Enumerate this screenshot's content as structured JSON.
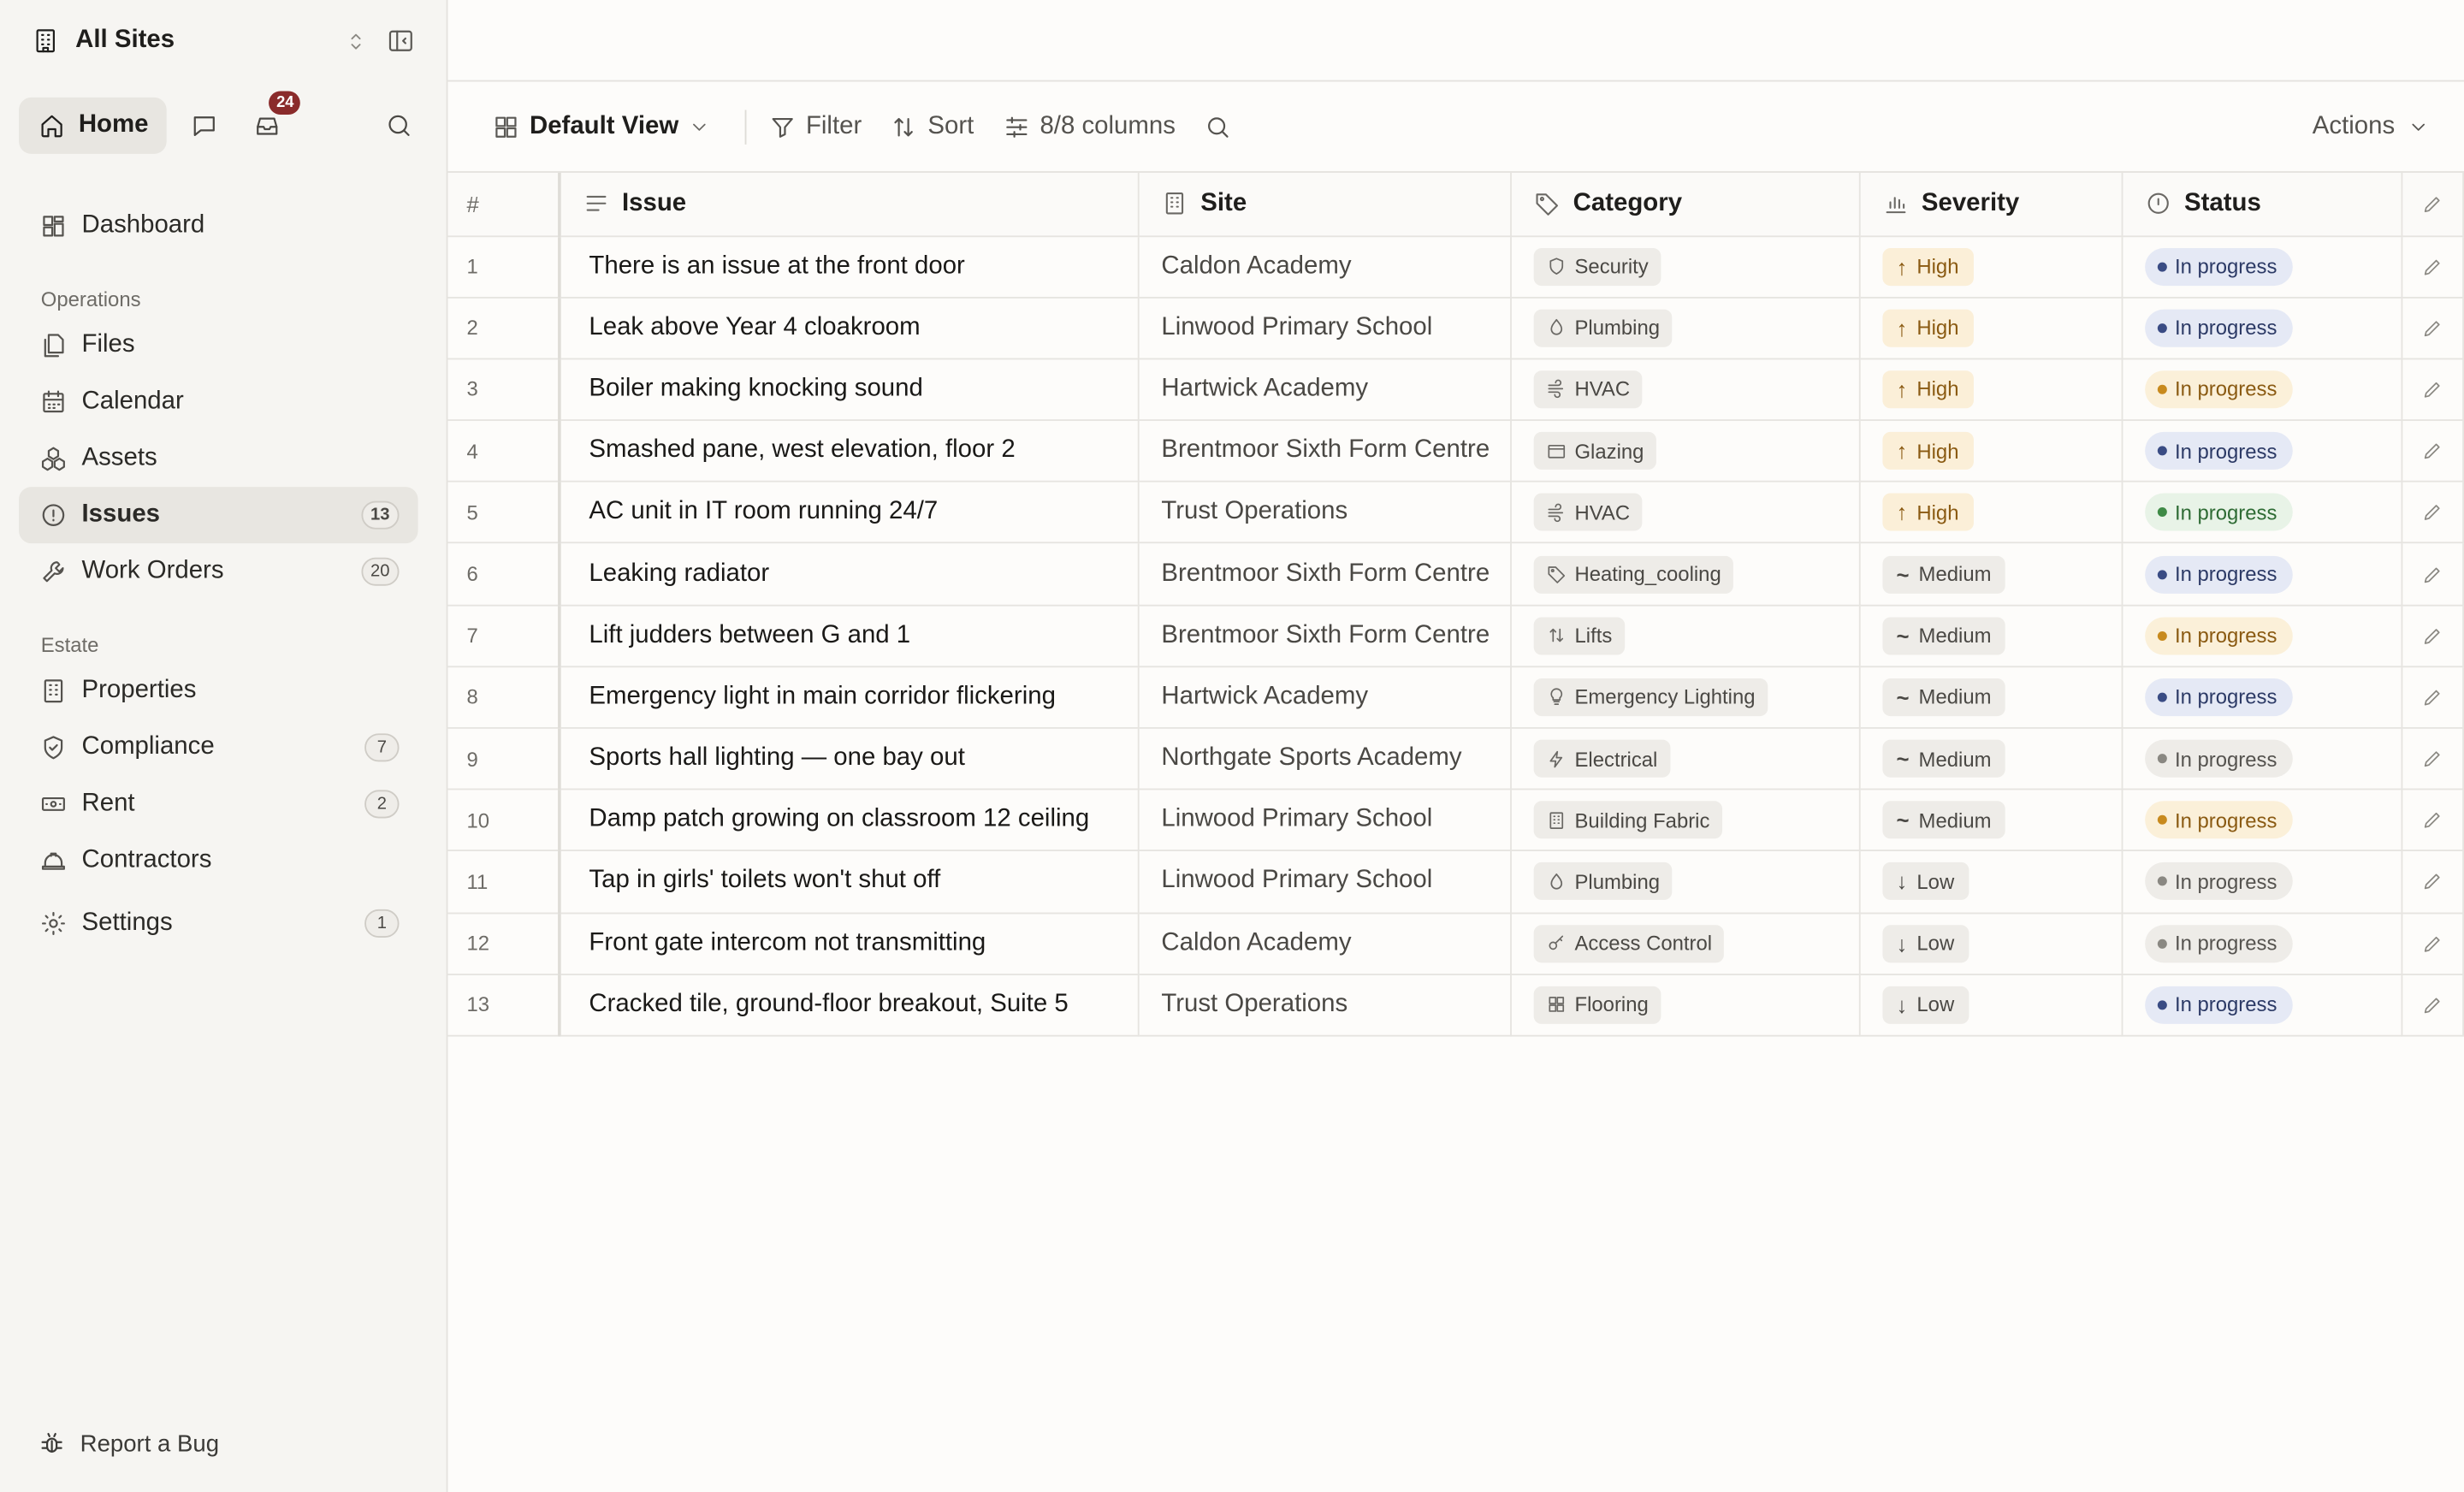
{
  "site_switcher": {
    "label": "All Sites"
  },
  "top_nav": {
    "home_label": "Home",
    "inbox_count": "24"
  },
  "sidebar": {
    "dashboard": "Dashboard",
    "operations_label": "Operations",
    "operations": [
      {
        "label": "Files",
        "icon": "files-icon",
        "count": ""
      },
      {
        "label": "Calendar",
        "icon": "calendar-icon",
        "count": ""
      },
      {
        "label": "Assets",
        "icon": "assets-icon",
        "count": ""
      },
      {
        "label": "Issues",
        "icon": "alert-circle-icon",
        "count": "13",
        "active": true
      },
      {
        "label": "Work Orders",
        "icon": "wrench-icon",
        "count": "20"
      }
    ],
    "estate_label": "Estate",
    "estate": [
      {
        "label": "Properties",
        "icon": "building-icon",
        "count": ""
      },
      {
        "label": "Compliance",
        "icon": "shield-check-icon",
        "count": "7"
      },
      {
        "label": "Rent",
        "icon": "banknote-icon",
        "count": "2"
      },
      {
        "label": "Contractors",
        "icon": "hard-hat-icon",
        "count": ""
      }
    ],
    "settings": {
      "label": "Settings",
      "count": "1"
    },
    "report_bug": "Report a Bug"
  },
  "toolbar": {
    "view_label": "Default View",
    "filter_label": "Filter",
    "sort_label": "Sort",
    "columns_label": "8/8 columns",
    "actions_label": "Actions"
  },
  "table": {
    "headers": {
      "num": "#",
      "issue": "Issue",
      "site": "Site",
      "category": "Category",
      "severity": "Severity",
      "status": "Status"
    },
    "rows": [
      {
        "n": "1",
        "issue": "There is an issue at the front door",
        "site": "Caldon Academy",
        "category": "Security",
        "cat_icon": "shield-icon",
        "severity": "High",
        "status": "In progress",
        "status_color": "blue"
      },
      {
        "n": "2",
        "issue": "Leak above Year 4 cloakroom",
        "site": "Linwood Primary School",
        "category": "Plumbing",
        "cat_icon": "droplet-icon",
        "severity": "High",
        "status": "In progress",
        "status_color": "blue"
      },
      {
        "n": "3",
        "issue": "Boiler making knocking sound",
        "site": "Hartwick Academy",
        "category": "HVAC",
        "cat_icon": "wind-icon",
        "severity": "High",
        "status": "In progress",
        "status_color": "amber"
      },
      {
        "n": "4",
        "issue": "Smashed pane, west elevation, floor 2",
        "site": "Brentmoor Sixth Form Centre",
        "category": "Glazing",
        "cat_icon": "window-icon",
        "severity": "High",
        "status": "In progress",
        "status_color": "blue"
      },
      {
        "n": "5",
        "issue": "AC unit in IT room running 24/7",
        "site": "Trust Operations",
        "category": "HVAC",
        "cat_icon": "wind-icon",
        "severity": "High",
        "status": "In progress",
        "status_color": "green"
      },
      {
        "n": "6",
        "issue": "Leaking radiator",
        "site": "Brentmoor Sixth Form Centre",
        "category": "Heating_cooling",
        "cat_icon": "tag-icon",
        "severity": "Medium",
        "status": "In progress",
        "status_color": "blue"
      },
      {
        "n": "7",
        "issue": "Lift judders between G and 1",
        "site": "Brentmoor Sixth Form Centre",
        "category": "Lifts",
        "cat_icon": "arrows-up-down-icon",
        "severity": "Medium",
        "status": "In progress",
        "status_color": "amber"
      },
      {
        "n": "8",
        "issue": "Emergency light in main corridor flickering",
        "site": "Hartwick Academy",
        "category": "Emergency Lighting",
        "cat_icon": "lightbulb-icon",
        "severity": "Medium",
        "status": "In progress",
        "status_color": "blue"
      },
      {
        "n": "9",
        "issue": "Sports hall lighting — one bay out",
        "site": "Northgate Sports Academy",
        "category": "Electrical",
        "cat_icon": "zap-icon",
        "severity": "Medium",
        "status": "In progress",
        "status_color": "gray"
      },
      {
        "n": "10",
        "issue": "Damp patch growing on classroom 12 ceiling",
        "site": "Linwood Primary School",
        "category": "Building Fabric",
        "cat_icon": "building-icon",
        "severity": "Medium",
        "status": "In progress",
        "status_color": "amber"
      },
      {
        "n": "11",
        "issue": "Tap in girls' toilets won't shut off",
        "site": "Linwood Primary School",
        "category": "Plumbing",
        "cat_icon": "droplet-icon",
        "severity": "Low",
        "status": "In progress",
        "status_color": "gray"
      },
      {
        "n": "12",
        "issue": "Front gate intercom not transmitting",
        "site": "Caldon Academy",
        "category": "Access Control",
        "cat_icon": "key-icon",
        "severity": "Low",
        "status": "In progress",
        "status_color": "gray"
      },
      {
        "n": "13",
        "issue": "Cracked tile, ground-floor breakout, Suite 5",
        "site": "Trust Operations",
        "category": "Flooring",
        "cat_icon": "grid-icon",
        "severity": "Low",
        "status": "In progress",
        "status_color": "blue"
      }
    ]
  }
}
